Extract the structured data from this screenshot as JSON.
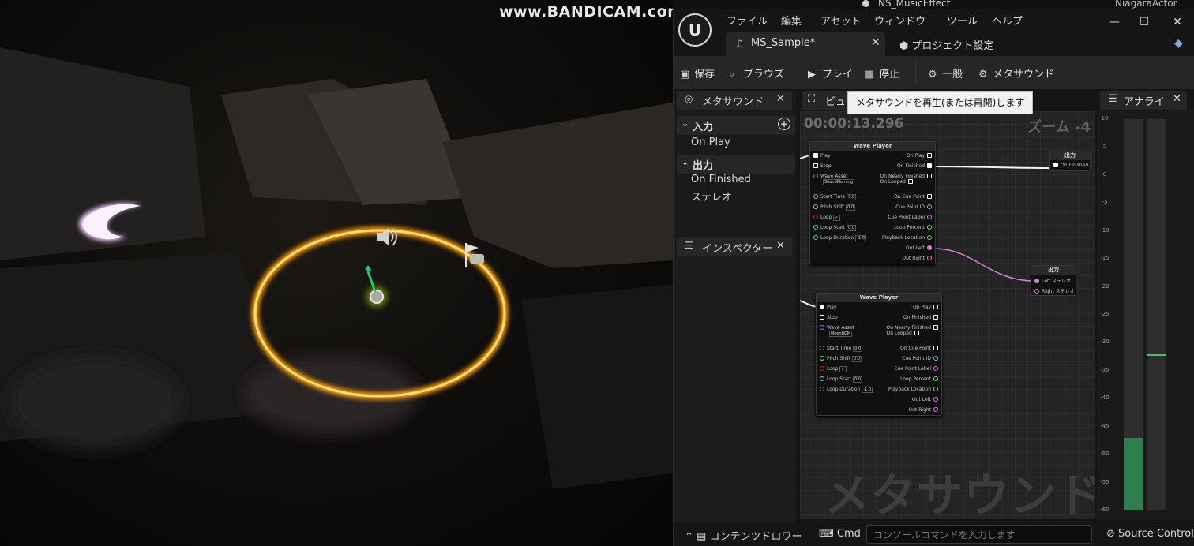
{
  "watermark": "www.BANDICAM.com",
  "top_strip": {
    "effect_name": "NS_MusicEffect",
    "actor_name": "NiagaraActor"
  },
  "menu": [
    "ファイル",
    "編集",
    "アセット",
    "ウィンドウ",
    "ツール",
    "ヘルプ"
  ],
  "window_buttons": {
    "minimize": "—",
    "maximize": "☐",
    "close": "✕"
  },
  "tabs": {
    "doc_label": "MS_Sample*",
    "doc_close": "✕",
    "project_label": "プロジェクト設定"
  },
  "toolbar": {
    "save": "保存",
    "browse": "ブラウズ",
    "play": "プレイ",
    "stop": "停止",
    "general": "一般",
    "metasound": "メタサウンド"
  },
  "tooltip": "メタサウンドを再生(または再開)します",
  "left_panel": {
    "tab_label": "メタサウンド",
    "close": "✕",
    "input_header": "入力",
    "inputs": [
      "On Play"
    ],
    "output_header": "出力",
    "outputs": [
      "On Finished",
      "ステレオ"
    ],
    "inspector_label": "インスペクター"
  },
  "graph": {
    "tab_label": "ビュ",
    "timecode": "00:00:13.296",
    "zoom": "ズーム -4",
    "watermark": "メタサウンド",
    "wave_player_title": "Wave Player",
    "inputs": {
      "play": "Play",
      "stop": "Stop",
      "wave_asset": "Wave Asset",
      "start_time": "Start Time",
      "pitch_shift": "Pitch Shift",
      "loop": "Loop",
      "loop_start": "Loop Start",
      "loop_duration": "Loop Duration"
    },
    "outputs": {
      "on_play": "On Play",
      "on_finished": "On Finished",
      "on_nearly_finished": "On Nearly Finished",
      "on_looped": "On Looped",
      "on_cue_point": "On Cue Point",
      "cue_point_id": "Cue Point ID",
      "cue_point_label": "Cue Point Label",
      "loop_percent": "Loop Percent",
      "playback_location": "Playback Location",
      "out_left": "Out Left",
      "out_right": "Out Right"
    },
    "node1_asset": "SoundMorning",
    "node2_asset": "MoonBGM",
    "values": {
      "zero": "0.0",
      "minus_one": "-1.0",
      "check": "✓"
    },
    "output_node_title": "出力",
    "output_on_finished": "On Finished",
    "output_left": "Left ステレオ",
    "output_right": "Right ステレオ"
  },
  "analyzer": {
    "tab_label": "アナライ",
    "close": "✕",
    "ticks": [
      "10",
      "5",
      "0",
      "-5",
      "-10",
      "-15",
      "-20",
      "-25",
      "-30",
      "-35",
      "-40",
      "-45",
      "-50",
      "-55",
      "-60"
    ],
    "meter_left_level_db": -47,
    "meter_right_peak_db": -32
  },
  "bottombar": {
    "content_drawer": "コンテンツドロワー",
    "cmd": "Cmd",
    "console_placeholder": "コンソールコマンドを入力します",
    "source_control": "Source Control"
  }
}
